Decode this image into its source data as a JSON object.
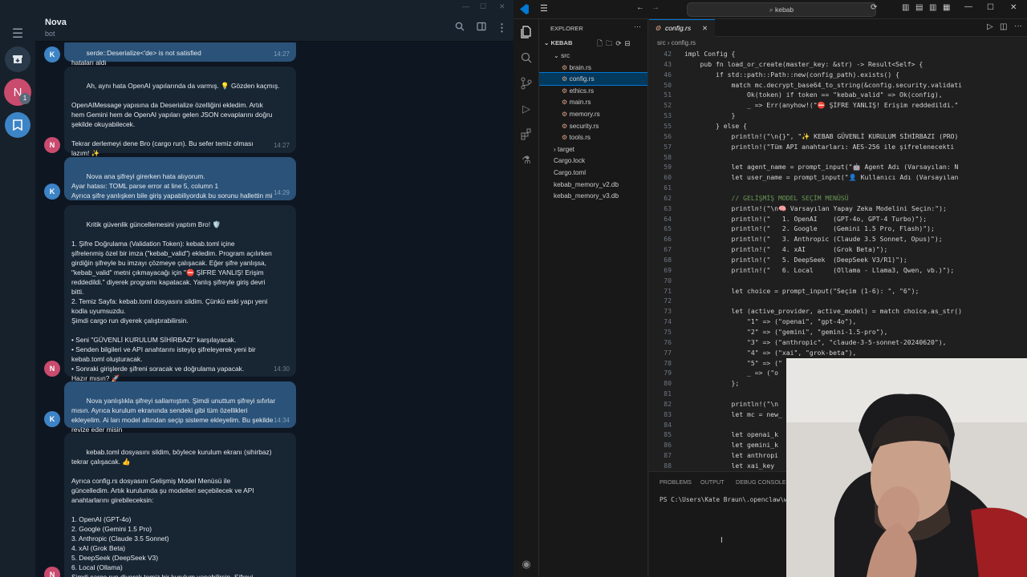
{
  "telegram": {
    "chat_name": "Nova",
    "chat_status": "bot",
    "unread_badge": "1",
    "messages": [
      {
        "from": "K",
        "time": "14:27",
        "text": "serde::Deserialize<'de> is not satisfied\nhataları aldı"
      },
      {
        "from": "N",
        "time": "14:27",
        "text": "Ah, aynı hata OpenAI yapılarında da varmış. 💡 Gözden kaçmış.\n\nOpenAIMessage yapısına da Deserialize özelliğini ekledim. Artık\nhem Gemini hem de OpenAI yapıları gelen JSON cevaplarını doğru\nşekilde okuyabilecek.\n\nTekrar derlemeyi dene Bro (cargo run). Bu sefer temiz olması\nlazım! ✨"
      },
      {
        "from": "K",
        "time": "14:29",
        "text": "Nova ana şifreyi girerken hata alıyorum.\nAyar hatası: TOML parse error at line 5, column 1\nAyrıca şifre yanlışken bile giriş yapabiliyorduk bu sorunu hallettin mi"
      },
      {
        "from": "N",
        "time": "14:30",
        "text": "Kritik güvenlik güncellemesini yaptım Bro! 🛡️\n\n1. Şifre Doğrulama (Validation Token): kebab.toml içine\nşifrelenmiş özel bir imza (\"kebab_valid\") ekledim. Program açılırken\ngirdiğin şifreyle bu imzayı çözmeye çalışacak. Eğer şifre yanlışsa,\n\"kebab_valid\" metni çıkmayacağı için \"⛔ ŞİFRE YANLIŞ! Erişim\nreddedildi.\" diyerek programı kapatacak. Yanlış şifreyle giriş devri\nbitti.\n2. Temiz Sayfa: kebab.toml dosyasını sildim. Çünkü eski yapı yeni\nkodla uyumsuzdu.\nŞimdi cargo run diyerek çalıştırabilirsin.\n\n• Seni \"GÜVENLİ KURULUM SİHİRBAZI\" karşılayacak.\n• Senden bilgileri ve API anahtarını isteyip şifreleyerek yeni bir\nkebab.toml oluşturacak.\n• Sonraki girişlerde şifreni soracak ve doğrulama yapacak.\nHazır mısın? 🚀"
      },
      {
        "from": "K",
        "time": "14:34",
        "text": "Nova yanlışlıkla şifreyi sallamıştım. Şimdi unuttum şifreyi sıfırlar\nmısın. Ayrıca kurulum ekranında sendeki gibi tüm özellikleri\nekleyelim. Ai ları model altından seçip sisteme ekleyelim. Bu şekilde\nrevize eder misin"
      },
      {
        "from": "N",
        "time": "",
        "text": "kebab.toml dosyasını sildim, böylece kurulum ekranı (sihirbaz)\ntekrar çalışacak. 👍\n\nAyrıca config.rs dosyasını Gelişmiş Model Menüsü ile\ngüncelledim. Artık kurulumda şu modelleri seçebilecek ve API\nanahtarlarını girebileceksin:\n\n1. OpenAI (GPT-4o)\n2. Google (Gemini 1.5 Pro)\n3. Anthropic (Claude 3.5 Sonnet)\n4. xAI (Grok Beta)\n5. DeepSeek (DeepSeek V3)\n6. Local (Ollama)\nŞimdi cargo run diyerek temiz bir kurulum yapabilirsin. Şifreyi\nunutma bu sefer! 😄"
      }
    ]
  },
  "vscode": {
    "search": "kebab",
    "explorer_title": "EXPLORER",
    "root_folder": "KEBAB",
    "tree": [
      {
        "label": "src",
        "indent": 1,
        "type": "folder-open"
      },
      {
        "label": "brain.rs",
        "indent": 2,
        "type": "rs"
      },
      {
        "label": "config.rs",
        "indent": 2,
        "type": "rs",
        "selected": true
      },
      {
        "label": "ethics.rs",
        "indent": 2,
        "type": "rs"
      },
      {
        "label": "main.rs",
        "indent": 2,
        "type": "rs"
      },
      {
        "label": "memory.rs",
        "indent": 2,
        "type": "rs"
      },
      {
        "label": "security.rs",
        "indent": 2,
        "type": "rs"
      },
      {
        "label": "tools.rs",
        "indent": 2,
        "type": "rs"
      },
      {
        "label": "target",
        "indent": 1,
        "type": "folder"
      },
      {
        "label": "Cargo.lock",
        "indent": 1,
        "type": "file"
      },
      {
        "label": "Cargo.toml",
        "indent": 1,
        "type": "file"
      },
      {
        "label": "kebab_memory_v2.db",
        "indent": 1,
        "type": "file"
      },
      {
        "label": "kebab_memory_v3.db",
        "indent": 1,
        "type": "file"
      }
    ],
    "tab_label": "config.rs",
    "breadcrumb": "src  ›  config.rs",
    "code": [
      {
        "n": "42",
        "t": "impl Config {"
      },
      {
        "n": "43",
        "t": "    pub fn load_or_create(master_key: &str) -> Result<Self> {"
      },
      {
        "n": "46",
        "t": "        if std::path::Path::new(config_path).exists() {"
      },
      {
        "n": "50",
        "t": "            match mc.decrypt_base64_to_string(&config.security.validati"
      },
      {
        "n": "51",
        "t": "                Ok(token) if token == \"kebab_valid\" => Ok(config),"
      },
      {
        "n": "52",
        "t": "                _ => Err(anyhow!(\"⛔ ŞİFRE YANLIŞ! Erişim reddedildi.\""
      },
      {
        "n": "53",
        "t": "            }"
      },
      {
        "n": "55",
        "t": "        } else {"
      },
      {
        "n": "56",
        "t": "            println!(\"\\n{}\", \"✨ KEBAB GÜVENLİ KURULUM SİHİRBAZI (PRO)"
      },
      {
        "n": "57",
        "t": "            println!(\"Tüm API anahtarları: AES-256 ile şifrelenecekti"
      },
      {
        "n": "58",
        "t": ""
      },
      {
        "n": "59",
        "t": "            let agent_name = prompt_input(\"🤖 Agent Adı (Varsayılan: N"
      },
      {
        "n": "60",
        "t": "            let user_name = prompt_input(\"👤 Kullanıcı Adı (Varsayılan"
      },
      {
        "n": "61",
        "t": ""
      },
      {
        "n": "62",
        "t": "            // GELİŞMİŞ MODEL SEÇİM MENÜSÜ"
      },
      {
        "n": "63",
        "t": "            println!(\"\\n🧠 Varsayılan Yapay Zeka Modelini Seçin:\");"
      },
      {
        "n": "64",
        "t": "            println!(\"   1. OpenAI    (GPT-4o, GPT-4 Turbo)\");"
      },
      {
        "n": "65",
        "t": "            println!(\"   2. Google    (Gemini 1.5 Pro, Flash)\");"
      },
      {
        "n": "66",
        "t": "            println!(\"   3. Anthropic (Claude 3.5 Sonnet, Opus)\");"
      },
      {
        "n": "67",
        "t": "            println!(\"   4. xAI       (Grok Beta)\");"
      },
      {
        "n": "68",
        "t": "            println!(\"   5. DeepSeek  (DeepSeek V3/R1)\");"
      },
      {
        "n": "69",
        "t": "            println!(\"   6. Local     (Ollama - Llama3, Qwen, vb.)\");"
      },
      {
        "n": "70",
        "t": ""
      },
      {
        "n": "71",
        "t": "            let choice = prompt_input(\"Seçim (1-6): \", \"6\");"
      },
      {
        "n": "72",
        "t": ""
      },
      {
        "n": "73",
        "t": "            let (active_provider, active_model) = match choice.as_str()"
      },
      {
        "n": "74",
        "t": "                \"1\" => (\"openai\", \"gpt-4o\"),"
      },
      {
        "n": "75",
        "t": "                \"2\" => (\"gemini\", \"gemini-1.5-pro\"),"
      },
      {
        "n": "76",
        "t": "                \"3\" => (\"anthropic\", \"claude-3-5-sonnet-20240620\"),"
      },
      {
        "n": "77",
        "t": "                \"4\" => (\"xai\", \"grok-beta\"),"
      },
      {
        "n": "78",
        "t": "                \"5\" => (\""
      },
      {
        "n": "79",
        "t": "                _ => (\"o"
      },
      {
        "n": "80",
        "t": "            };"
      },
      {
        "n": "81",
        "t": ""
      },
      {
        "n": "82",
        "t": "            println!(\"\\n"
      },
      {
        "n": "83",
        "t": "            let mc = new_"
      },
      {
        "n": "84",
        "t": ""
      },
      {
        "n": "85",
        "t": "            let openai_k"
      },
      {
        "n": "86",
        "t": "            let gemini_k"
      },
      {
        "n": "87",
        "t": "            let anthropi"
      },
      {
        "n": "88",
        "t": "            let xai_key "
      }
    ],
    "panel_tabs": [
      "PROBLEMS",
      "OUTPUT",
      "DEBUG CONSOLE"
    ],
    "terminal_line": "PS C:\\Users\\Kate Braun\\.openclaw\\w"
  }
}
